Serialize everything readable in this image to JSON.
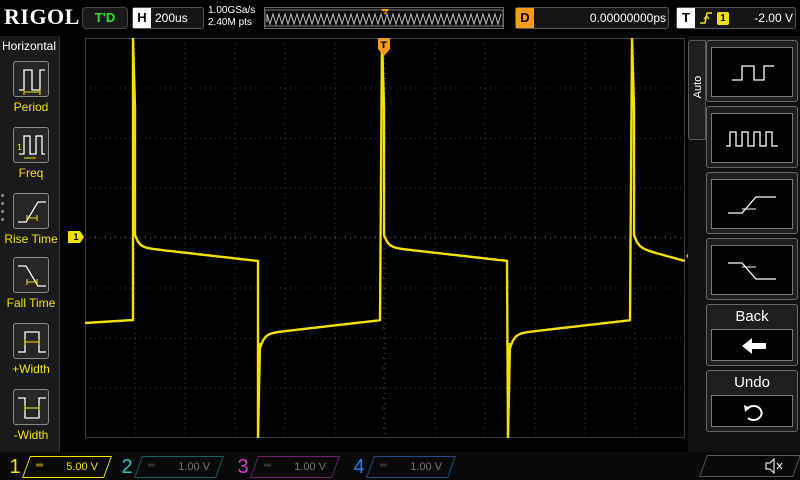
{
  "brand": "RIGOL",
  "status": {
    "run_state": "T'D"
  },
  "horizontal": {
    "label": "H",
    "timebase": "200us",
    "sample_rate": "1.00GSa/s",
    "memory_depth": "2.40M pts"
  },
  "delay": {
    "label": "D",
    "value": "0.00000000ps"
  },
  "trigger": {
    "label": "T",
    "source_channel": "1",
    "level": "-2.00 V",
    "edge": "rising"
  },
  "left_menu": {
    "title": "Horizontal",
    "items": [
      {
        "label": "Period",
        "icon": "period-measure-icon"
      },
      {
        "label": "Freq",
        "icon": "frequency-measure-icon"
      },
      {
        "label": "Rise Time",
        "icon": "rise-time-icon"
      },
      {
        "label": "Fall Time",
        "icon": "fall-time-icon"
      },
      {
        "label": "+Width",
        "icon": "positive-width-icon"
      },
      {
        "label": "-Width",
        "icon": "negative-width-icon"
      }
    ]
  },
  "right_menu": {
    "tab_label": "Auto",
    "buttons": [
      {
        "icon": "single-pulse-icon"
      },
      {
        "icon": "pulse-train-icon"
      },
      {
        "icon": "rising-edge-icon"
      },
      {
        "icon": "falling-edge-icon"
      }
    ],
    "back_label": "Back",
    "undo_label": "Undo"
  },
  "channels": [
    {
      "num": "1",
      "scale": "5.00 V",
      "color": "#f5e100",
      "active": true
    },
    {
      "num": "2",
      "scale": "1.00 V",
      "color": "#1fc4c0",
      "active": false
    },
    {
      "num": "3",
      "scale": "1.00 V",
      "color": "#d536d5",
      "active": false
    },
    {
      "num": "4",
      "scale": "1.00 V",
      "color": "#2f7de0",
      "active": false
    }
  ],
  "colors": {
    "trace": "#f5e100",
    "trigger_marker": "#f79b19",
    "grid": "#4a4a4a",
    "run_state": "#27e02a"
  }
}
